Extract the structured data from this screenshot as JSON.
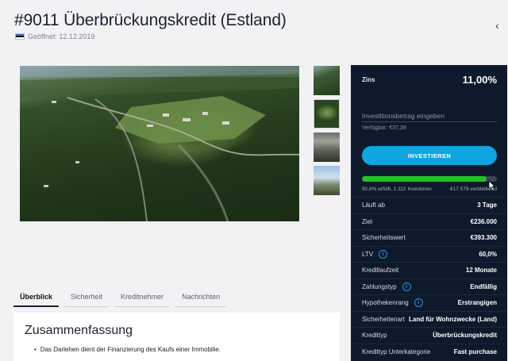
{
  "header": {
    "title": "#9011 Überbrückungskredit (Estland)",
    "opened": "Geöffnet: 12.12.2019",
    "back_icon": "‹"
  },
  "tabs": [
    {
      "label": "Überblick",
      "active": true
    },
    {
      "label": "Sicherheit",
      "active": false
    },
    {
      "label": "Kreditnehmer",
      "active": false
    },
    {
      "label": "Nachrichten",
      "active": false
    }
  ],
  "summary": {
    "heading": "Zusammenfassung",
    "bullet": "Das Darlehen dient der Finanzierung des Kaufs einer Immobilie."
  },
  "invest_panel": {
    "zins_label": "Zins",
    "zins_value": "11,00%",
    "input_placeholder": "Investitionsbetrag eingeben",
    "available": "Verfügbar: €37,39",
    "button_label": "INVESTIEREN",
    "progress_percent": 92.6,
    "progress_left": "92,6% erfüllt, 1.112 Investoren",
    "progress_right": "€17.579 verbleibend"
  },
  "details": [
    {
      "label": "Läuft ab",
      "value": "3 Tage",
      "info": false
    },
    {
      "label": "Ziel",
      "value": "€236.000",
      "info": false
    },
    {
      "label": "Sicherheitswert",
      "value": "€393.300",
      "info": false
    },
    {
      "label": "LTV",
      "value": "60,0%",
      "info": true
    },
    {
      "label": "Kreditlaufzeit",
      "value": "12 Monate",
      "info": false
    },
    {
      "label": "Zahlungstyp",
      "value": "Endfällig",
      "info": true
    },
    {
      "label": "Hypothekenrang",
      "value": "Erstrangigen",
      "info": true
    },
    {
      "label": "Sicherheitenart",
      "value": "Land für Wohnzwecke (Land)",
      "info": false
    },
    {
      "label": "Kredittyp",
      "value": "Überbrückungskredit",
      "info": false
    },
    {
      "label": "Kredittyp Unterkategorie",
      "value": "Fast purchase",
      "info": false
    }
  ],
  "colors": {
    "panel_bg": "#0e1a2c",
    "accent": "#0ea5e0",
    "progress": "#22c324"
  }
}
